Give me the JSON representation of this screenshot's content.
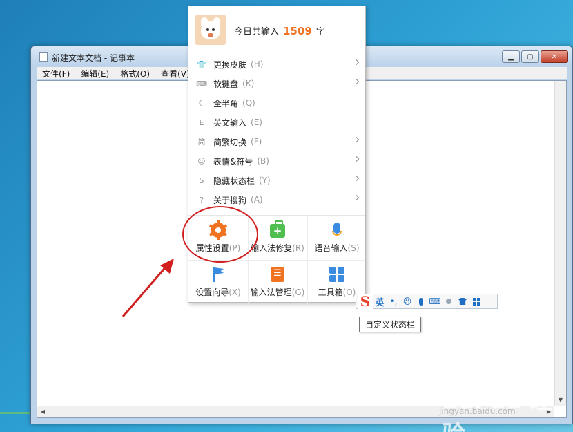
{
  "window": {
    "title": "新建文本文档 - 记事本",
    "minimize": "▁",
    "maximize": "▢",
    "close": "✕"
  },
  "menubar": [
    "文件(F)",
    "编辑(E)",
    "格式(O)",
    "查看(V)"
  ],
  "sogou_menu": {
    "header_prefix": "今日共输入",
    "header_count": "1509",
    "header_suffix": "字",
    "items": [
      {
        "label": "更换皮肤",
        "key": "(H)",
        "icon": "tshirt-icon",
        "glyph": "👕",
        "submenu": true
      },
      {
        "label": "软键盘",
        "key": "(K)",
        "icon": "keyboard-icon",
        "glyph": "⌨",
        "submenu": true
      },
      {
        "label": "全半角",
        "key": "(Q)",
        "icon": "moon-icon",
        "glyph": "☾",
        "submenu": false
      },
      {
        "label": "英文输入",
        "key": "(E)",
        "icon": "english-e-icon",
        "glyph": "E",
        "submenu": false
      },
      {
        "label": "简繁切换",
        "key": "(F)",
        "icon": "jian-icon",
        "glyph": "简",
        "submenu": true
      },
      {
        "label": "表情&符号",
        "key": "(B)",
        "icon": "smiley-icon",
        "glyph": "☺",
        "submenu": true
      },
      {
        "label": "隐藏状态栏",
        "key": "(Y)",
        "icon": "hide-status-icon",
        "glyph": "S",
        "submenu": true
      },
      {
        "label": "关于搜狗",
        "key": "(A)",
        "icon": "question-icon",
        "glyph": "?",
        "submenu": true
      }
    ],
    "grid": [
      {
        "label": "属性设置",
        "key": "(P)"
      },
      {
        "label": "输入法修复",
        "key": "(R)"
      },
      {
        "label": "语音输入",
        "key": "(S)"
      },
      {
        "label": "设置向导",
        "key": "(X)"
      },
      {
        "label": "输入法管理",
        "key": "(G)"
      },
      {
        "label": "工具箱",
        "key": "(O)"
      }
    ]
  },
  "statusbar": {
    "logo": "S",
    "mode": "英",
    "punct": "•,",
    "smiley": "☺",
    "keyboard": "⌨",
    "tooltip": "自定义状态栏"
  },
  "watermark": {
    "main": "Bai du 经验",
    "sub": "jingyan.baidu.com"
  },
  "colors": {
    "accent_orange": "#f07322",
    "annotation_red": "#d11f1f",
    "icon_blue": "#3b8be0"
  }
}
